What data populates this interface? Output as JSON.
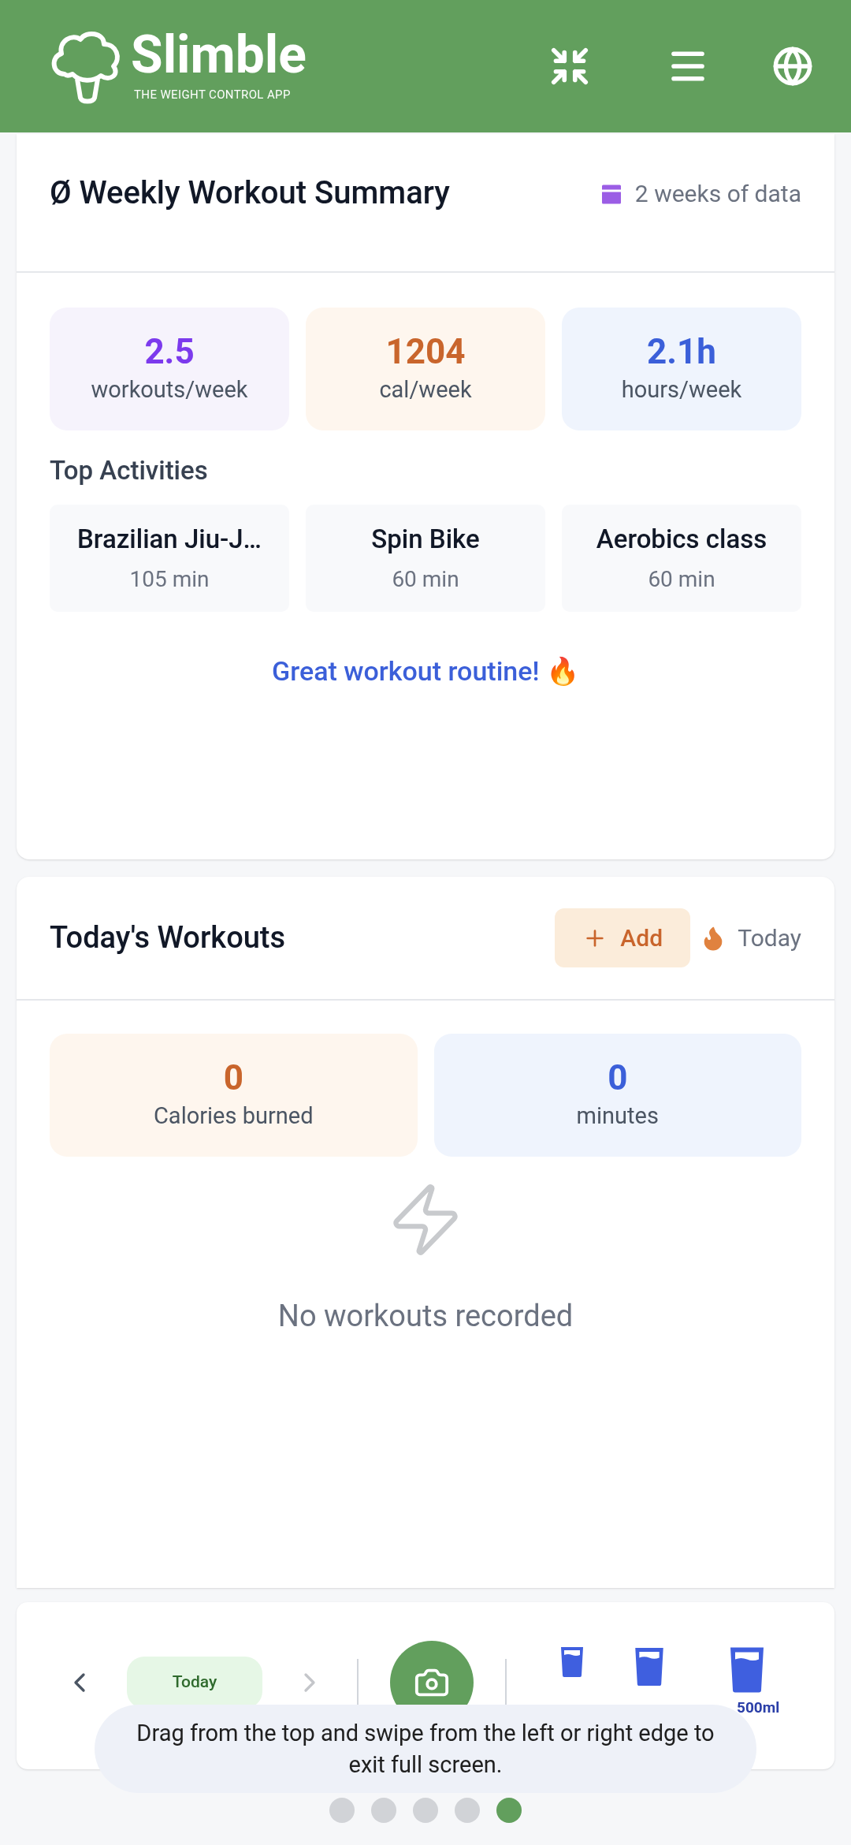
{
  "header": {
    "app_name": "Slimble",
    "tagline": "THE WEIGHT CONTROL APP"
  },
  "weekly_summary": {
    "title": "Ø Weekly Workout Summary",
    "badge": "2 weeks of data",
    "stats": [
      {
        "value": "2.5",
        "label": "workouts/week",
        "kind": "purple"
      },
      {
        "value": "1204",
        "label": "cal/week",
        "kind": "orange"
      },
      {
        "value": "2.1h",
        "label": "hours/week",
        "kind": "blue"
      }
    ],
    "section_title": "Top Activities",
    "activities": [
      {
        "name": "Brazilian Jiu-J…",
        "duration": "105 min"
      },
      {
        "name": "Spin Bike",
        "duration": "60 min"
      },
      {
        "name": "Aerobics class",
        "duration": "60 min"
      }
    ],
    "message": "Great workout routine! 🔥"
  },
  "todays_workouts": {
    "title": "Today's Workouts",
    "add_button": "Add",
    "badge": "Today",
    "stats": [
      {
        "value": "0",
        "label": "Calories burned",
        "kind": "orange"
      },
      {
        "value": "0",
        "label": "minutes",
        "kind": "blue"
      }
    ],
    "empty_text": "No workouts recorded"
  },
  "bottom_bar": {
    "date": "Today",
    "water": [
      {
        "kind": "small"
      },
      {
        "kind": "medium"
      },
      {
        "kind": "large",
        "label": "500ml"
      }
    ]
  },
  "toast": "Drag from the top and swipe from the left or right edge to exit full screen.",
  "page_dots": [
    {
      "selected": false
    },
    {
      "selected": false
    },
    {
      "selected": false
    },
    {
      "selected": false
    },
    {
      "selected": true
    }
  ]
}
